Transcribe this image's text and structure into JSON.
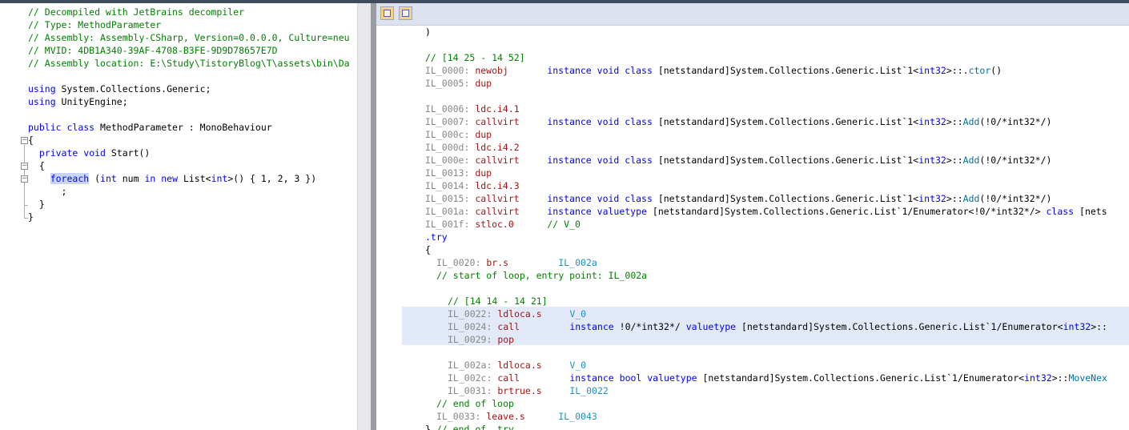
{
  "left": {
    "lines": [
      {
        "segs": [
          {
            "c": "cm",
            "t": "// Decompiled with JetBrains decompiler"
          }
        ]
      },
      {
        "segs": [
          {
            "c": "cm",
            "t": "// Type: MethodParameter"
          }
        ]
      },
      {
        "segs": [
          {
            "c": "cm",
            "t": "// Assembly: Assembly-CSharp, Version=0.0.0.0, Culture=neu"
          }
        ]
      },
      {
        "segs": [
          {
            "c": "cm",
            "t": "// MVID: 4DB1A340-39AF-4708-B3FE-9D9D78657E7D"
          }
        ]
      },
      {
        "segs": [
          {
            "c": "cm",
            "t": "// Assembly location: E:\\Study\\TistoryBlog\\T\\assets\\bin\\Da"
          }
        ]
      },
      {
        "segs": []
      },
      {
        "segs": [
          {
            "c": "kw",
            "t": "using"
          },
          {
            "c": "tx",
            "t": " System.Collections.Generic;"
          }
        ]
      },
      {
        "segs": [
          {
            "c": "kw",
            "t": "using"
          },
          {
            "c": "tx",
            "t": " UnityEngine;"
          }
        ]
      },
      {
        "segs": []
      },
      {
        "segs": [
          {
            "c": "kw",
            "t": "public"
          },
          {
            "c": "tx",
            "t": " "
          },
          {
            "c": "kw",
            "t": "class"
          },
          {
            "c": "tx",
            "t": " MethodParameter : MonoBehaviour"
          }
        ]
      },
      {
        "segs": [
          {
            "c": "tx",
            "t": "{"
          }
        ]
      },
      {
        "segs": [
          {
            "c": "tx",
            "t": "  "
          },
          {
            "c": "kw",
            "t": "private"
          },
          {
            "c": "tx",
            "t": " "
          },
          {
            "c": "kw",
            "t": "void"
          },
          {
            "c": "tx",
            "t": " Start()"
          }
        ]
      },
      {
        "segs": [
          {
            "c": "tx",
            "t": "  {"
          }
        ]
      },
      {
        "segs": [
          {
            "c": "tx",
            "t": "    "
          },
          {
            "c": "kw sel",
            "t": "foreach"
          },
          {
            "c": "tx",
            "t": " ("
          },
          {
            "c": "kw",
            "t": "int"
          },
          {
            "c": "tx",
            "t": " num "
          },
          {
            "c": "kw",
            "t": "in"
          },
          {
            "c": "tx",
            "t": " "
          },
          {
            "c": "kw",
            "t": "new"
          },
          {
            "c": "tx",
            "t": " List<"
          },
          {
            "c": "kw",
            "t": "int"
          },
          {
            "c": "tx",
            "t": ">() { 1, 2, 3 })"
          }
        ]
      },
      {
        "segs": [
          {
            "c": "tx",
            "t": "      ;"
          }
        ]
      },
      {
        "segs": [
          {
            "c": "tx",
            "t": "  }"
          }
        ]
      },
      {
        "segs": [
          {
            "c": "tx",
            "t": "}"
          }
        ]
      }
    ]
  },
  "right": {
    "toolbar": {
      "btn1": "toggle-il-view",
      "btn2": "toggle-source-view"
    },
    "lines": [
      {
        "i": 0,
        "segs": [
          {
            "c": "tx",
            "t": ")"
          }
        ]
      },
      {
        "i": 0,
        "segs": []
      },
      {
        "i": 0,
        "segs": [
          {
            "c": "cm",
            "t": "// [14 25 - 14 52]"
          }
        ]
      },
      {
        "i": 0,
        "segs": [
          {
            "c": "gray",
            "t": "IL_0000: "
          },
          {
            "c": "op",
            "t": "newobj       "
          },
          {
            "c": "kw",
            "t": "instance void class "
          },
          {
            "c": "tx",
            "t": "[netstandard]System.Collections.Generic.List`1<"
          },
          {
            "c": "kw",
            "t": "int32"
          },
          {
            "c": "tx",
            "t": ">::."
          },
          {
            "c": "ma",
            "t": "ctor"
          },
          {
            "c": "tx",
            "t": "()"
          }
        ]
      },
      {
        "i": 0,
        "segs": [
          {
            "c": "gray",
            "t": "IL_0005: "
          },
          {
            "c": "op",
            "t": "dup"
          }
        ]
      },
      {
        "i": 0,
        "segs": []
      },
      {
        "i": 0,
        "segs": [
          {
            "c": "gray",
            "t": "IL_0006: "
          },
          {
            "c": "op",
            "t": "ldc.i4.1"
          }
        ]
      },
      {
        "i": 0,
        "segs": [
          {
            "c": "gray",
            "t": "IL_0007: "
          },
          {
            "c": "op",
            "t": "callvirt     "
          },
          {
            "c": "kw",
            "t": "instance void class "
          },
          {
            "c": "tx",
            "t": "[netstandard]System.Collections.Generic.List`1<"
          },
          {
            "c": "kw",
            "t": "int32"
          },
          {
            "c": "tx",
            "t": ">::"
          },
          {
            "c": "ma",
            "t": "Add"
          },
          {
            "c": "tx",
            "t": "(!0/*int32*/)"
          }
        ]
      },
      {
        "i": 0,
        "segs": [
          {
            "c": "gray",
            "t": "IL_000c: "
          },
          {
            "c": "op",
            "t": "dup"
          }
        ]
      },
      {
        "i": 0,
        "segs": [
          {
            "c": "gray",
            "t": "IL_000d: "
          },
          {
            "c": "op",
            "t": "ldc.i4.2"
          }
        ]
      },
      {
        "i": 0,
        "segs": [
          {
            "c": "gray",
            "t": "IL_000e: "
          },
          {
            "c": "op",
            "t": "callvirt     "
          },
          {
            "c": "kw",
            "t": "instance void class "
          },
          {
            "c": "tx",
            "t": "[netstandard]System.Collections.Generic.List`1<"
          },
          {
            "c": "kw",
            "t": "int32"
          },
          {
            "c": "tx",
            "t": ">::"
          },
          {
            "c": "ma",
            "t": "Add"
          },
          {
            "c": "tx",
            "t": "(!0/*int32*/)"
          }
        ]
      },
      {
        "i": 0,
        "segs": [
          {
            "c": "gray",
            "t": "IL_0013: "
          },
          {
            "c": "op",
            "t": "dup"
          }
        ]
      },
      {
        "i": 0,
        "segs": [
          {
            "c": "gray",
            "t": "IL_0014: "
          },
          {
            "c": "op",
            "t": "ldc.i4.3"
          }
        ]
      },
      {
        "i": 0,
        "segs": [
          {
            "c": "gray",
            "t": "IL_0015: "
          },
          {
            "c": "op",
            "t": "callvirt     "
          },
          {
            "c": "kw",
            "t": "instance void class "
          },
          {
            "c": "tx",
            "t": "[netstandard]System.Collections.Generic.List`1<"
          },
          {
            "c": "kw",
            "t": "int32"
          },
          {
            "c": "tx",
            "t": ">::"
          },
          {
            "c": "ma",
            "t": "Add"
          },
          {
            "c": "tx",
            "t": "(!0/*int32*/)"
          }
        ]
      },
      {
        "i": 0,
        "segs": [
          {
            "c": "gray",
            "t": "IL_001a: "
          },
          {
            "c": "op",
            "t": "callvirt     "
          },
          {
            "c": "kw",
            "t": "instance valuetype "
          },
          {
            "c": "tx",
            "t": "[netstandard]System.Collections.Generic.List`1/Enumerator<!0/*int32*/> "
          },
          {
            "c": "kw",
            "t": "class "
          },
          {
            "c": "tx",
            "t": "[nets"
          }
        ]
      },
      {
        "i": 0,
        "segs": [
          {
            "c": "gray",
            "t": "IL_001f: "
          },
          {
            "c": "op",
            "t": "stloc.0      "
          },
          {
            "c": "cm",
            "t": "// V_0"
          }
        ]
      },
      {
        "i": 0,
        "segs": [
          {
            "c": "kw",
            "t": ".try"
          }
        ]
      },
      {
        "i": 0,
        "segs": [
          {
            "c": "tx",
            "t": "{"
          }
        ]
      },
      {
        "i": 1,
        "segs": [
          {
            "c": "gray",
            "t": "IL_0020: "
          },
          {
            "c": "op",
            "t": "br.s         "
          },
          {
            "c": "lab",
            "t": "IL_002a"
          }
        ]
      },
      {
        "i": 1,
        "segs": [
          {
            "c": "cm",
            "t": "// start of loop, entry point: IL_002a"
          }
        ]
      },
      {
        "i": 1,
        "segs": []
      },
      {
        "i": 2,
        "segs": [
          {
            "c": "cm",
            "t": "// [14 14 - 14 21]"
          }
        ]
      },
      {
        "i": 2,
        "segs": [
          {
            "c": "gray",
            "t": "IL_0022: "
          },
          {
            "c": "op",
            "t": "ldloca.s     "
          },
          {
            "c": "lab",
            "t": "V_0"
          }
        ]
      },
      {
        "i": 2,
        "segs": [
          {
            "c": "gray",
            "t": "IL_0024: "
          },
          {
            "c": "op",
            "t": "call         "
          },
          {
            "c": "kw",
            "t": "instance "
          },
          {
            "c": "tx",
            "t": "!0/*int32*/ "
          },
          {
            "c": "kw",
            "t": "valuetype "
          },
          {
            "c": "tx",
            "t": "[netstandard]System.Collections.Generic.List`1/Enumerator<"
          },
          {
            "c": "kw",
            "t": "int32"
          },
          {
            "c": "tx",
            "t": ">::"
          }
        ]
      },
      {
        "i": 2,
        "segs": [
          {
            "c": "gray",
            "t": "IL_0029: "
          },
          {
            "c": "op",
            "t": "pop"
          }
        ]
      },
      {
        "i": 2,
        "segs": []
      },
      {
        "i": 2,
        "segs": [
          {
            "c": "gray",
            "t": "IL_002a: "
          },
          {
            "c": "op",
            "t": "ldloca.s     "
          },
          {
            "c": "lab",
            "t": "V_0"
          }
        ]
      },
      {
        "i": 2,
        "segs": [
          {
            "c": "gray",
            "t": "IL_002c: "
          },
          {
            "c": "op",
            "t": "call         "
          },
          {
            "c": "kw",
            "t": "instance bool valuetype "
          },
          {
            "c": "tx",
            "t": "[netstandard]System.Collections.Generic.List`1/Enumerator<"
          },
          {
            "c": "kw",
            "t": "int32"
          },
          {
            "c": "tx",
            "t": ">::"
          },
          {
            "c": "ma",
            "t": "MoveNex"
          }
        ]
      },
      {
        "i": 2,
        "segs": [
          {
            "c": "gray",
            "t": "IL_0031: "
          },
          {
            "c": "op",
            "t": "brtrue.s     "
          },
          {
            "c": "lab",
            "t": "IL_0022"
          }
        ]
      },
      {
        "i": 1,
        "segs": [
          {
            "c": "cm",
            "t": "// end of loop"
          }
        ]
      },
      {
        "i": 1,
        "segs": [
          {
            "c": "gray",
            "t": "IL_0033: "
          },
          {
            "c": "op",
            "t": "leave.s      "
          },
          {
            "c": "lab",
            "t": "IL_0043"
          }
        ]
      },
      {
        "i": 0,
        "segs": [
          {
            "c": "tx",
            "t": "} "
          },
          {
            "c": "cm",
            "t": "// end of .try"
          }
        ]
      }
    ]
  },
  "colors": {
    "comment": "#008000",
    "keyword": "#0000ff",
    "opcode": "#a31515",
    "il_offset": "#868686",
    "label": "#1e90c8",
    "highlight": "#e2e9f8"
  }
}
